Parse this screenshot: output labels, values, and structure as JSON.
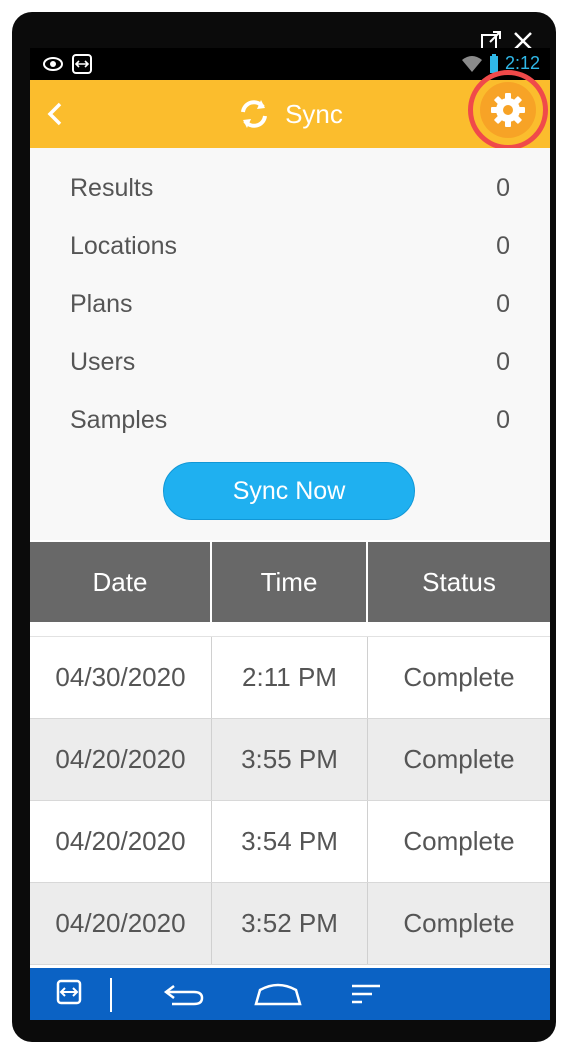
{
  "app": {
    "title": "Sync"
  },
  "status_bar": {
    "time": "2:12"
  },
  "counts": [
    {
      "label": "Results",
      "value": "0"
    },
    {
      "label": "Locations",
      "value": "0"
    },
    {
      "label": "Plans",
      "value": "0"
    },
    {
      "label": "Users",
      "value": "0"
    },
    {
      "label": "Samples",
      "value": "0"
    }
  ],
  "sync_button": {
    "label": "Sync Now"
  },
  "table": {
    "headers": [
      "Date",
      "Time",
      "Status"
    ],
    "rows": [
      {
        "date": "04/30/2020",
        "time": "2:11 PM",
        "status": "Complete"
      },
      {
        "date": "04/20/2020",
        "time": "3:55 PM",
        "status": "Complete"
      },
      {
        "date": "04/20/2020",
        "time": "3:54 PM",
        "status": "Complete"
      },
      {
        "date": "04/20/2020",
        "time": "3:52 PM",
        "status": "Complete"
      }
    ]
  },
  "icons": {
    "back": "chevron-left-icon",
    "sync": "sync-icon",
    "settings": "gear-icon",
    "external": "external-link-icon",
    "close": "close-icon",
    "nav_back": "back-arrow-icon",
    "nav_home": "home-icon",
    "nav_recent": "recent-apps-icon"
  },
  "colors": {
    "app_bar": "#fbbd2d",
    "highlight": "#f04a4a",
    "button": "#1fb0f0",
    "table_header": "#686868",
    "nav_bar": "#0b62c4"
  }
}
